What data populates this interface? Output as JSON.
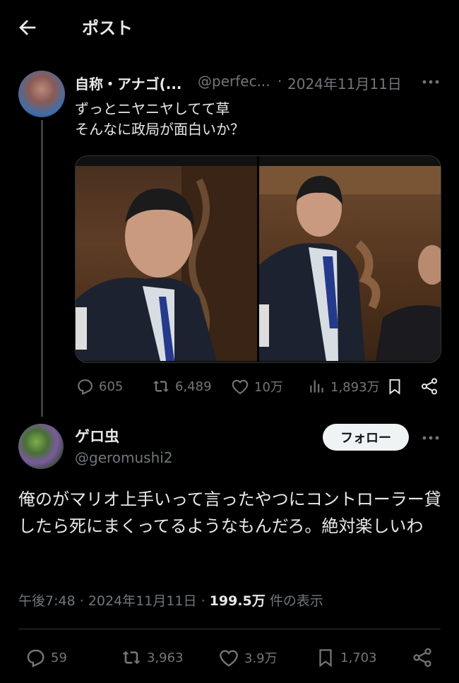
{
  "header": {
    "title": "ポスト"
  },
  "parent_post": {
    "display_name": "自称・アナゴ(...",
    "handle": "@perfec...",
    "separator": "·",
    "date": "2024年11月11日",
    "text_line1": "ずっとニヤニヤしてて草",
    "text_line2": "そんなに政局が面白いか？",
    "stats": {
      "replies": "605",
      "reposts": "6,489",
      "likes": "10万",
      "views": "1,893万"
    }
  },
  "reply_post": {
    "display_name": "ゲロ虫",
    "handle": "@geromushi2",
    "follow_label": "フォロー",
    "text": "俺のがマリオ上手いって言ったやつにコントローラー貸したら死にまくってるようなもんだろ。絶対楽しいわ",
    "time": "午後7:48",
    "dot": "·",
    "date": "2024年11月11日",
    "views_count": "199.5万",
    "views_label": "件の表示",
    "stats": {
      "replies": "59",
      "reposts": "3,963",
      "likes": "3.9万",
      "bookmarks": "1,703"
    }
  },
  "icons": [
    "back-arrow-icon",
    "more-icon",
    "reply-icon",
    "repost-icon",
    "like-icon",
    "views-icon",
    "bookmark-icon",
    "share-icon"
  ],
  "colors": {
    "background": "#000000",
    "text": "#e7e9ea",
    "muted": "#71767b",
    "follow_bg": "#eff3f4"
  }
}
